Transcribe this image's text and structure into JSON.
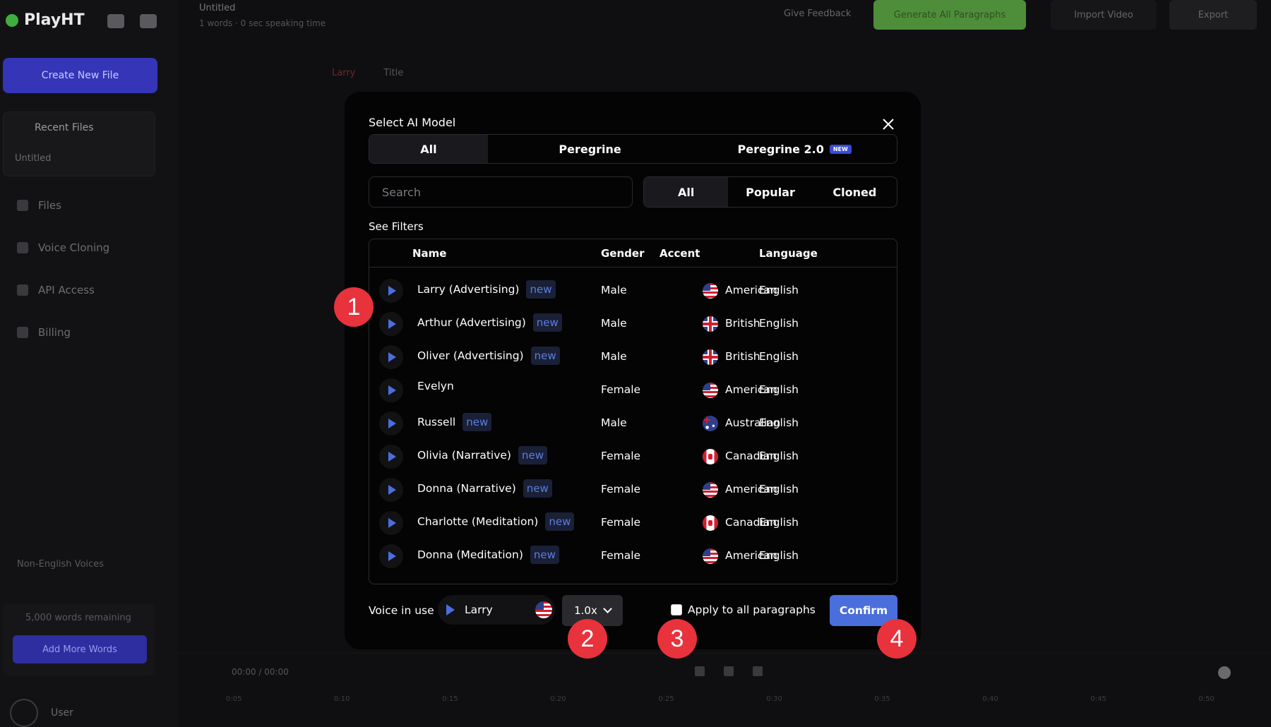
{
  "app": {
    "logo": "PlayHT",
    "create_button": "Create New File",
    "recent_files": "Recent Files",
    "recent_item": "Untitled",
    "nav": [
      "Files",
      "Voice Cloning",
      "API Access",
      "Billing"
    ],
    "non_english": "Non-English Voices",
    "words_remaining": "5,000 words remaining",
    "add_words": "Add More Words",
    "user": "User",
    "file_name": "Untitled",
    "file_sub": "1 words · 0 sec speaking time",
    "give_feedback": "Give Feedback",
    "generate_all": "Generate All Paragraphs",
    "import_video": "Import Video",
    "export": "Export",
    "main_tabs": [
      "Larry",
      "Title"
    ],
    "time": "00:00 / 00:00",
    "ruler": [
      "0:05",
      "0:10",
      "0:15",
      "0:20",
      "0:25",
      "0:30",
      "0:35",
      "0:40",
      "0:45",
      "0:50"
    ]
  },
  "modal": {
    "title": "Select AI Model",
    "model_tabs": [
      {
        "label": "All",
        "active": true
      },
      {
        "label": "Peregrine",
        "active": false
      },
      {
        "label": "Peregrine 2.0",
        "badge": "NEW",
        "active": false
      }
    ],
    "search_placeholder": "Search",
    "filter_tabs": [
      {
        "label": "All",
        "active": true
      },
      {
        "label": "Popular",
        "active": false
      },
      {
        "label": "Cloned",
        "active": false
      }
    ],
    "see_filters": "See Filters",
    "columns": {
      "name": "Name",
      "gender": "Gender",
      "accent": "Accent",
      "language": "Language"
    },
    "voices": [
      {
        "name": "Larry (Advertising)",
        "new": true,
        "gender": "Male",
        "accent": "American",
        "flag": "us",
        "language": "English"
      },
      {
        "name": "Arthur (Advertising)",
        "new": true,
        "gender": "Male",
        "accent": "British",
        "flag": "gb",
        "language": "English"
      },
      {
        "name": "Oliver (Advertising)",
        "new": true,
        "gender": "Male",
        "accent": "British",
        "flag": "gb",
        "language": "English"
      },
      {
        "name": "Evelyn",
        "new": false,
        "gender": "Female",
        "accent": "American",
        "flag": "us",
        "language": "English"
      },
      {
        "name": "Russell",
        "new": true,
        "gender": "Male",
        "accent": "Australian",
        "flag": "au",
        "language": "English"
      },
      {
        "name": "Olivia (Narrative)",
        "new": true,
        "gender": "Female",
        "accent": "Canadian",
        "flag": "ca",
        "language": "English"
      },
      {
        "name": "Donna (Narrative)",
        "new": true,
        "gender": "Female",
        "accent": "American",
        "flag": "us",
        "language": "English"
      },
      {
        "name": "Charlotte (Meditation)",
        "new": true,
        "gender": "Female",
        "accent": "Canadian",
        "flag": "ca",
        "language": "English"
      },
      {
        "name": "Donna (Meditation)",
        "new": true,
        "gender": "Female",
        "accent": "American",
        "flag": "us",
        "language": "English"
      }
    ],
    "new_tag": "new",
    "voice_in_use_label": "Voice in use",
    "voice_in_use": "Larry",
    "speed": "1.0x",
    "apply_label": "Apply to all paragraphs",
    "confirm": "Confirm"
  },
  "callouts": [
    "1",
    "2",
    "3",
    "4"
  ],
  "colors": {
    "accent": "#4a6fdc",
    "callout": "#e8323c",
    "new_tag": "#5b7de2"
  }
}
